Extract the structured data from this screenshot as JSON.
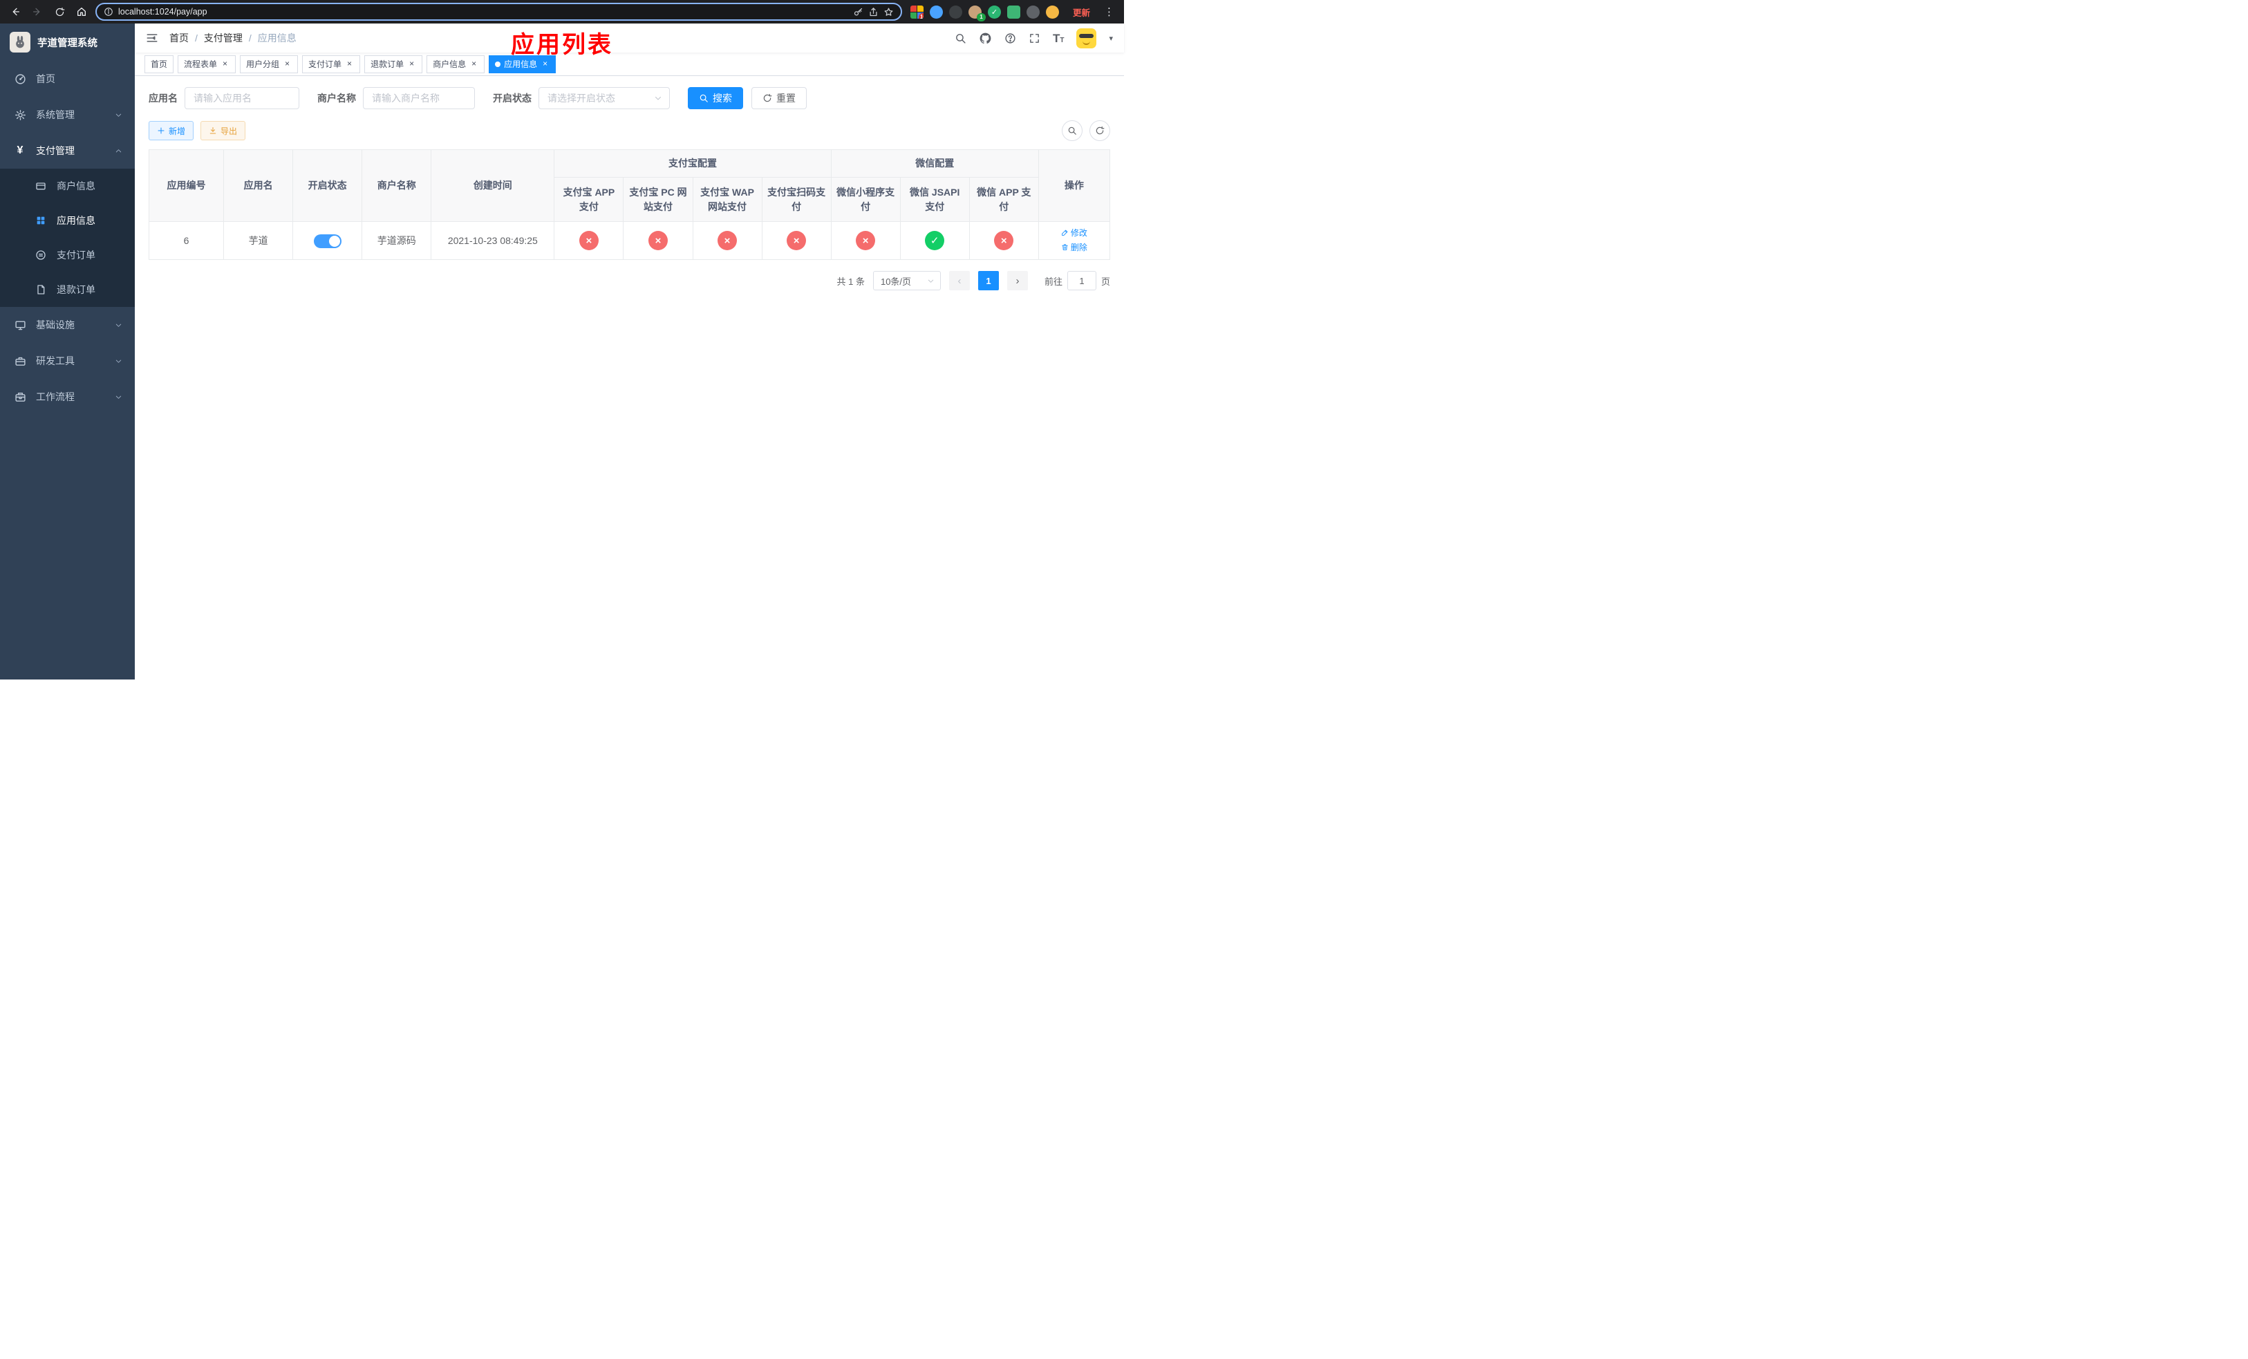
{
  "colors": {
    "primary": "#1890ff",
    "success": "#13ce66",
    "danger": "#f56c6c",
    "warning": "#e6a23c",
    "annotation": "#ff0000",
    "sidebar_bg": "#304156",
    "submenu_bg": "#1f2d3d",
    "active_icon": "#409eff"
  },
  "icons": {
    "close": "×",
    "caret_down": "▾",
    "dots": "⋮",
    "yen": "¥",
    "check": "✓",
    "cross": "×",
    "font_size_big": "T",
    "font_size_small": "T"
  },
  "browser": {
    "url": "localhost:1024/pay/app",
    "update_label": "更新",
    "extensions_badge_grid": "10",
    "extensions_badge_avatar": "1"
  },
  "sidebar": {
    "title": "芋道管理系统",
    "items": [
      {
        "label": "首页"
      },
      {
        "label": "系统管理"
      },
      {
        "label": "支付管理"
      },
      {
        "label": "商户信息"
      },
      {
        "label": "应用信息"
      },
      {
        "label": "支付订单"
      },
      {
        "label": "退款订单"
      },
      {
        "label": "基础设施"
      },
      {
        "label": "研发工具"
      },
      {
        "label": "工作流程"
      }
    ]
  },
  "header": {
    "breadcrumb": [
      "首页",
      "支付管理",
      "应用信息"
    ],
    "separator": "/",
    "annotation": "应用列表"
  },
  "tabs": [
    {
      "label": "首页"
    },
    {
      "label": "流程表单"
    },
    {
      "label": "用户分组"
    },
    {
      "label": "支付订单"
    },
    {
      "label": "退款订单"
    },
    {
      "label": "商户信息"
    },
    {
      "label": "应用信息"
    }
  ],
  "filters": {
    "app_name": {
      "label": "应用名",
      "placeholder": "请输入应用名",
      "value": ""
    },
    "merchant_name": {
      "label": "商户名称",
      "placeholder": "请输入商户名称",
      "value": ""
    },
    "status": {
      "label": "开启状态",
      "placeholder": "请选择开启状态"
    },
    "search_label": "搜索",
    "reset_label": "重置"
  },
  "toolbar": {
    "add_label": "新增",
    "export_label": "导出"
  },
  "table": {
    "headers": {
      "app_id": "应用编号",
      "app_name": "应用名",
      "status": "开启状态",
      "merchant": "商户名称",
      "created": "创建时间",
      "alipay_group": "支付宝配置",
      "wechat_group": "微信配置",
      "channels": [
        "支付宝 APP 支付",
        "支付宝 PC 网站支付",
        "支付宝 WAP 网站支付",
        "支付宝扫码支付",
        "微信小程序支付",
        "微信 JSAPI 支付",
        "微信 APP 支付"
      ],
      "actions": "操作"
    },
    "row": {
      "app_id": "6",
      "app_name": "芋道",
      "status_on": true,
      "merchant": "芋道源码",
      "created": "2021-10-23 08:49:25",
      "channels": [
        "no",
        "no",
        "no",
        "no",
        "no",
        "yes",
        "no"
      ],
      "edit_label": "修改",
      "delete_label": "删除"
    }
  },
  "pagination": {
    "total": "共 1 条",
    "page_size": "10条/页",
    "prev": "‹",
    "next": "›",
    "page": "1",
    "goto_label": "前往",
    "goto_value": "1",
    "goto_suffix": "页"
  }
}
